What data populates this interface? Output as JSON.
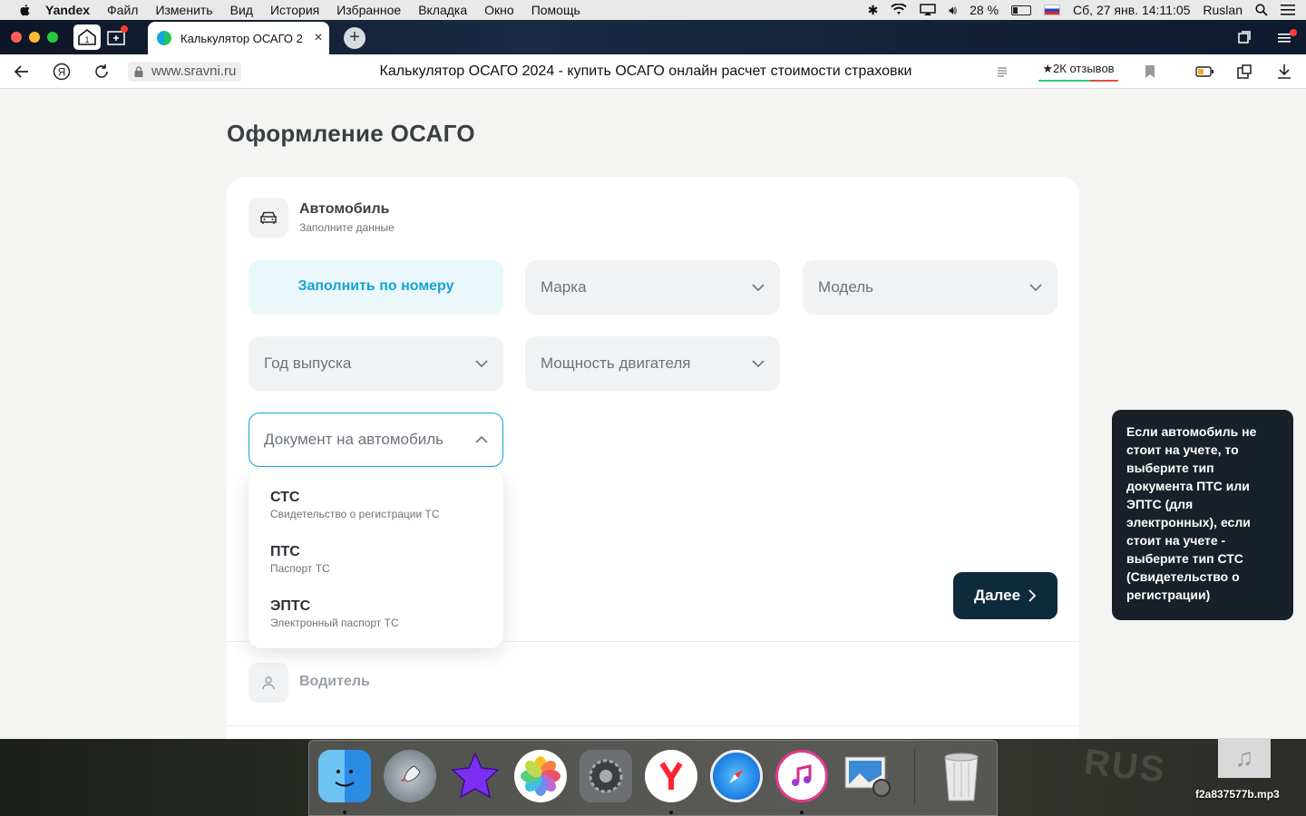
{
  "menubar": {
    "app": "Yandex",
    "items": [
      "Файл",
      "Изменить",
      "Вид",
      "История",
      "Избранное",
      "Вкладка",
      "Окно",
      "Помощь"
    ],
    "battery": "28 %",
    "datetime": "Сб, 27 янв.  14:11:05",
    "user": "Ruslan"
  },
  "browser": {
    "tab_title": "Калькулятор ОСАГО 2",
    "home_badge": "1",
    "url": "www.sravni.ru",
    "page_title": "Калькулятор ОСАГО 2024 - купить ОСАГО онлайн расчет стоимости страховки",
    "reviews": "★2К отзывов"
  },
  "page": {
    "heading": "Оформление ОСАГО",
    "car_section": {
      "title": "Автомобиль",
      "subtitle": "Заполните данные"
    },
    "fill_by_number": "Заполнить по номеру",
    "fields": {
      "brand": "Марка",
      "model": "Модель",
      "year": "Год выпуска",
      "power": "Мощность двигателя",
      "document": "Документ на автомобиль"
    },
    "document_options": [
      {
        "title": "СТС",
        "subtitle": "Свидетельство о регистрации ТС"
      },
      {
        "title": "ПТС",
        "subtitle": "Паспорт ТС"
      },
      {
        "title": "ЭПТС",
        "subtitle": "Электронный паспорт ТС"
      }
    ],
    "next_button": "Далее",
    "driver_section": {
      "title": "Водитель"
    },
    "tooltip": "Если автомобиль не стоит на учете, то выберите тип документа ПТС или ЭПТС (для электронных), если стоит на учете - выберите тип СТС (Свидетельство о регистрации)"
  },
  "desktop": {
    "file_name": "f2a837577b.mp3",
    "dock_apps": [
      "finder-icon",
      "launchpad-icon",
      "imovie-icon",
      "photos-icon",
      "system-preferences-icon",
      "yandex-browser-icon",
      "safari-icon",
      "itunes-icon",
      "preview-icon",
      "trash-icon"
    ]
  },
  "colors": {
    "accent": "#14a3d6",
    "primary_button": "#0e2a3d",
    "field_bg": "#f1f2f3",
    "tooltip_bg": "#182129"
  }
}
